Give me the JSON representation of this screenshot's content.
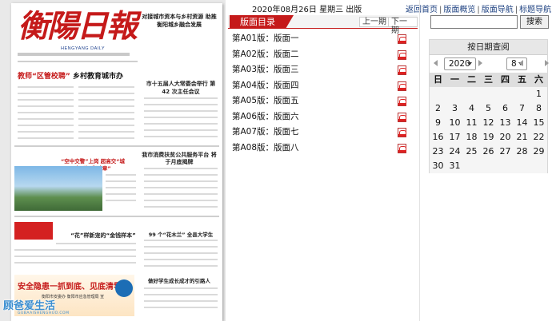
{
  "paper": {
    "masthead": "衡陽日報",
    "masthead_sub": "HENGYANG DAILY",
    "head_right": "对接城市资本与乡村资源 助推衡阳城乡融合发展",
    "head_main_red": "教师“区管校聘”",
    "head_main_black": " 乡村教育城市办",
    "head_mid": "市十五届人大常委会举行 第 42 次主任会议",
    "head_b": "我市消费扶贫公共服务平台 将于月底揭牌",
    "head_c": "“空中交警”上岗 超高交“城市”路”指违章”",
    "head_d": "“花”样新宠的“金钱样本”",
    "head_e": "99 个“花木兰” 全县大学生",
    "head_f": "做好学生成长成才的引路人",
    "ad_text": "安全隐患一抓到底、见底清零",
    "ad_sub": "衡阳市安委办 衡阳市应急管理局 宣",
    "watermark": "顾爸爱生活",
    "watermark_url": "GUBAAISHENGHUO.COM"
  },
  "header": {
    "date_info": "2020年08月26日 星期三 出版",
    "nav": [
      "返回首页",
      "版面概览",
      "版面导航",
      "标题导航"
    ]
  },
  "directory": {
    "title": "版面目录",
    "prev": "上一期",
    "next": "下一期",
    "items": [
      "第A01版：版面一",
      "第A02版：版面二",
      "第A03版：版面三",
      "第A04版：版面四",
      "第A05版：版面五",
      "第A06版：版面六",
      "第A07版：版面七",
      "第A08版：版面八"
    ]
  },
  "search": {
    "value": "",
    "button_label": "搜索"
  },
  "calendar": {
    "title": "按日期查阅",
    "year": "2020",
    "month": "8",
    "weekdays": [
      "日",
      "一",
      "二",
      "三",
      "四",
      "五",
      "六"
    ],
    "today": "26",
    "days": [
      "",
      "",
      "",
      "",
      "",
      "",
      "1",
      "2",
      "3",
      "4",
      "5",
      "6",
      "7",
      "8",
      "9",
      "10",
      "11",
      "12",
      "13",
      "14",
      "15",
      "16",
      "17",
      "18",
      "19",
      "20",
      "21",
      "22",
      "23",
      "24",
      "25",
      "26",
      "27",
      "28",
      "29",
      "30",
      "31",
      "",
      "",
      "",
      "",
      ""
    ]
  },
  "colors": {
    "accent_red": "#c51a1a",
    "link_blue": "#1c4080",
    "today_orange": "#c9642a"
  }
}
